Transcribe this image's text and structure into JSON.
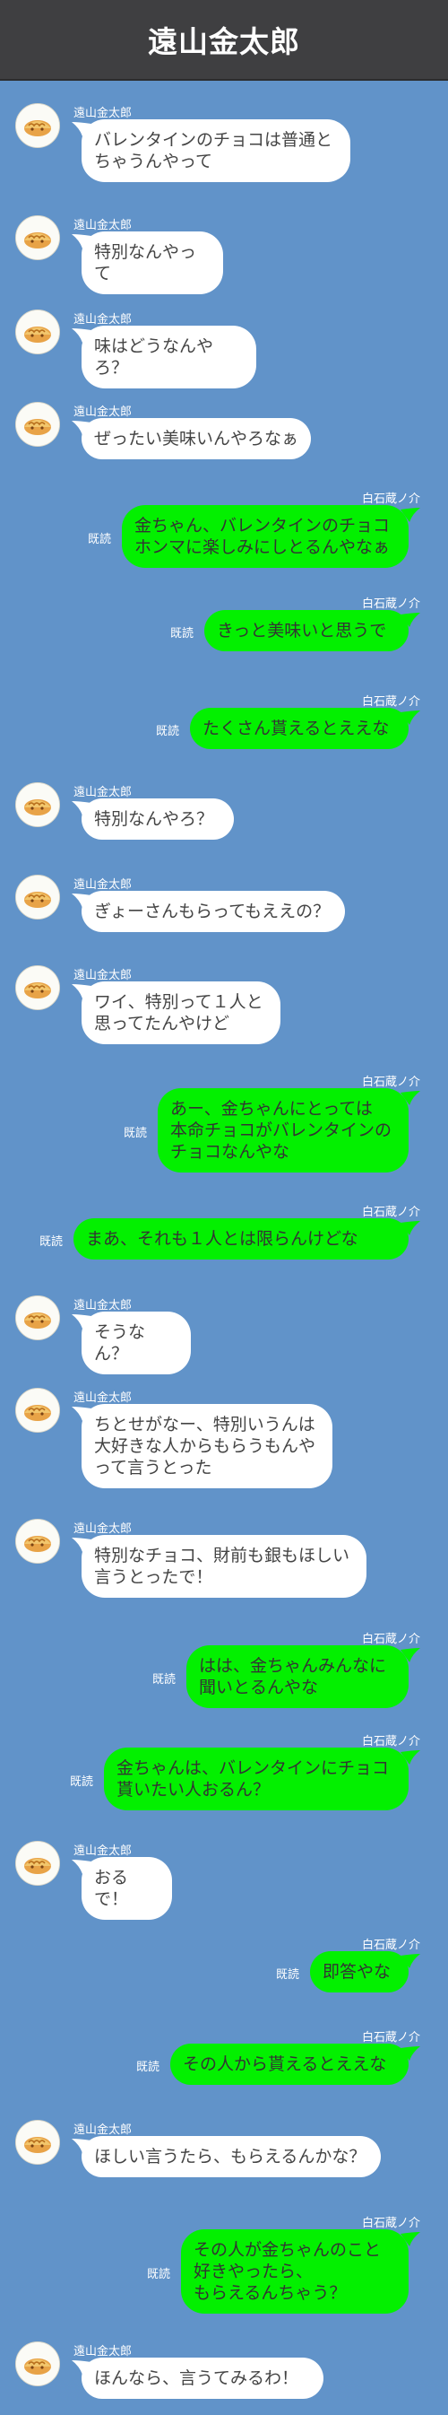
{
  "header": {
    "title": "遠山金太郎"
  },
  "contacts": {
    "left": "遠山金太郎",
    "right": "白石蔵ノ介"
  },
  "read_label": "既読",
  "messages": [
    {
      "side": "left",
      "text": "バレンタインのチョコは普通と\nちゃうんやって"
    },
    {
      "side": "left",
      "text": "特別なんやって"
    },
    {
      "side": "left",
      "text": "味はどうなんやろ？"
    },
    {
      "side": "left",
      "text": "ぜったい美味いんやろなぁ"
    },
    {
      "side": "right",
      "text": "金ちゃん、バレンタインのチョコ\nホンマに楽しみにしとるんやなぁ"
    },
    {
      "side": "right",
      "text": "きっと美味いと思うで"
    },
    {
      "side": "right",
      "text": "たくさん貰えるとええな"
    },
    {
      "side": "left",
      "text": "特別なんやろ？"
    },
    {
      "side": "left",
      "text": "ぎょーさんもらってもええの？"
    },
    {
      "side": "left",
      "text": "ワイ、特別って１人と\n思ってたんやけど"
    },
    {
      "side": "right",
      "text": "あー、金ちゃんにとっては\n本命チョコがバレンタインの\nチョコなんやな"
    },
    {
      "side": "right",
      "text": "まあ、それも１人とは限らんけどな"
    },
    {
      "side": "left",
      "text": "そうなん？"
    },
    {
      "side": "left",
      "text": "ちとせがなー、特別いうんは\n大好きな人からもらうもんや\nって言うとった"
    },
    {
      "side": "left",
      "text": "特別なチョコ、財前も銀もほしい\n言うとったで！"
    },
    {
      "side": "right",
      "text": "はは、金ちゃんみんなに\n聞いとるんやな"
    },
    {
      "side": "right",
      "text": "金ちゃんは、バレンタインにチョコ\n貰いたい人おるん？"
    },
    {
      "side": "left",
      "text": "おるで！"
    },
    {
      "side": "right",
      "text": "即答やな"
    },
    {
      "side": "right",
      "text": "その人から貰えるとええな"
    },
    {
      "side": "left",
      "text": "ほしい言うたら、もらえるんかな？"
    },
    {
      "side": "right",
      "text": "その人が金ちゃんのこと\n好きやったら、\nもらえるんちゃう？"
    },
    {
      "side": "left",
      "text": "ほんなら、言うてみるわ！"
    }
  ]
}
